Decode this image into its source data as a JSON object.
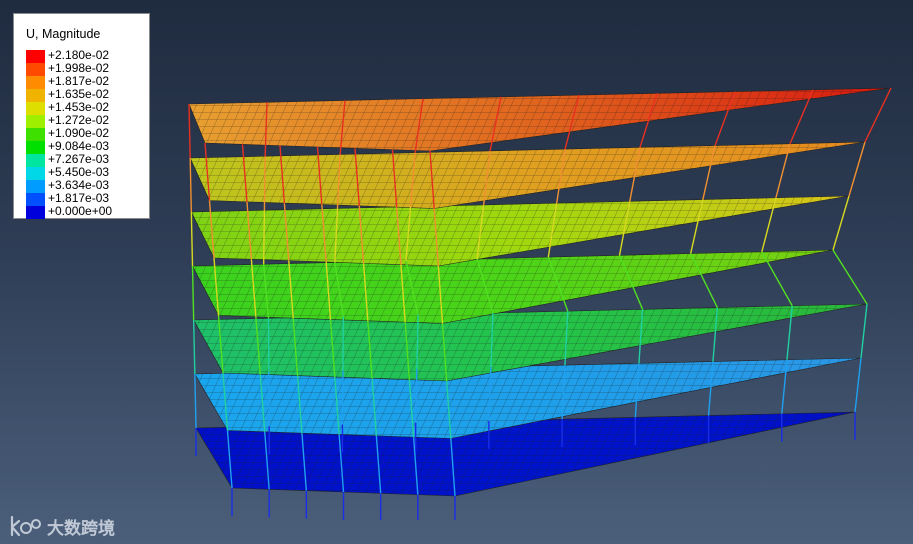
{
  "legend": {
    "title": "U, Magnitude",
    "entries": [
      {
        "label": "+2.180e-02",
        "color": "#ff0000"
      },
      {
        "label": "+1.998e-02",
        "color": "#ff4a00"
      },
      {
        "label": "+1.817e-02",
        "color": "#ff8c00"
      },
      {
        "label": "+1.635e-02",
        "color": "#f0b400"
      },
      {
        "label": "+1.453e-02",
        "color": "#dede00"
      },
      {
        "label": "+1.272e-02",
        "color": "#9ef000"
      },
      {
        "label": "+1.090e-02",
        "color": "#3ee000"
      },
      {
        "label": "+9.084e-03",
        "color": "#00e000"
      },
      {
        "label": "+7.267e-03",
        "color": "#00e6a0"
      },
      {
        "label": "+5.450e-03",
        "color": "#00d8e8"
      },
      {
        "label": "+3.634e-03",
        "color": "#009cff"
      },
      {
        "label": "+1.817e-03",
        "color": "#0050ff"
      },
      {
        "label": "+0.000e+00",
        "color": "#0000dc"
      }
    ]
  },
  "model": {
    "floors": [
      {
        "level": 1,
        "colors": [
          "#0010c8",
          "#0014cc",
          "#0010c8"
        ]
      },
      {
        "level": 2,
        "colors": [
          "#1aa6ee",
          "#1ea0ea",
          "#2a96e6"
        ]
      },
      {
        "level": 3,
        "colors": [
          "#1ec06a",
          "#24c44a",
          "#2ab83a"
        ]
      },
      {
        "level": 4,
        "colors": [
          "#3ad21e",
          "#4cd418",
          "#7ad010"
        ]
      },
      {
        "level": 5,
        "colors": [
          "#7ed214",
          "#a0d80e",
          "#d8c41a"
        ]
      },
      {
        "level": 6,
        "colors": [
          "#bcc81c",
          "#e0a020",
          "#e68a20"
        ]
      },
      {
        "level": 7,
        "colors": [
          "#e8a030",
          "#e0641e",
          "#d81810"
        ]
      }
    ]
  },
  "watermark": {
    "logo": "kdo-logo",
    "text": "大数跨境"
  }
}
